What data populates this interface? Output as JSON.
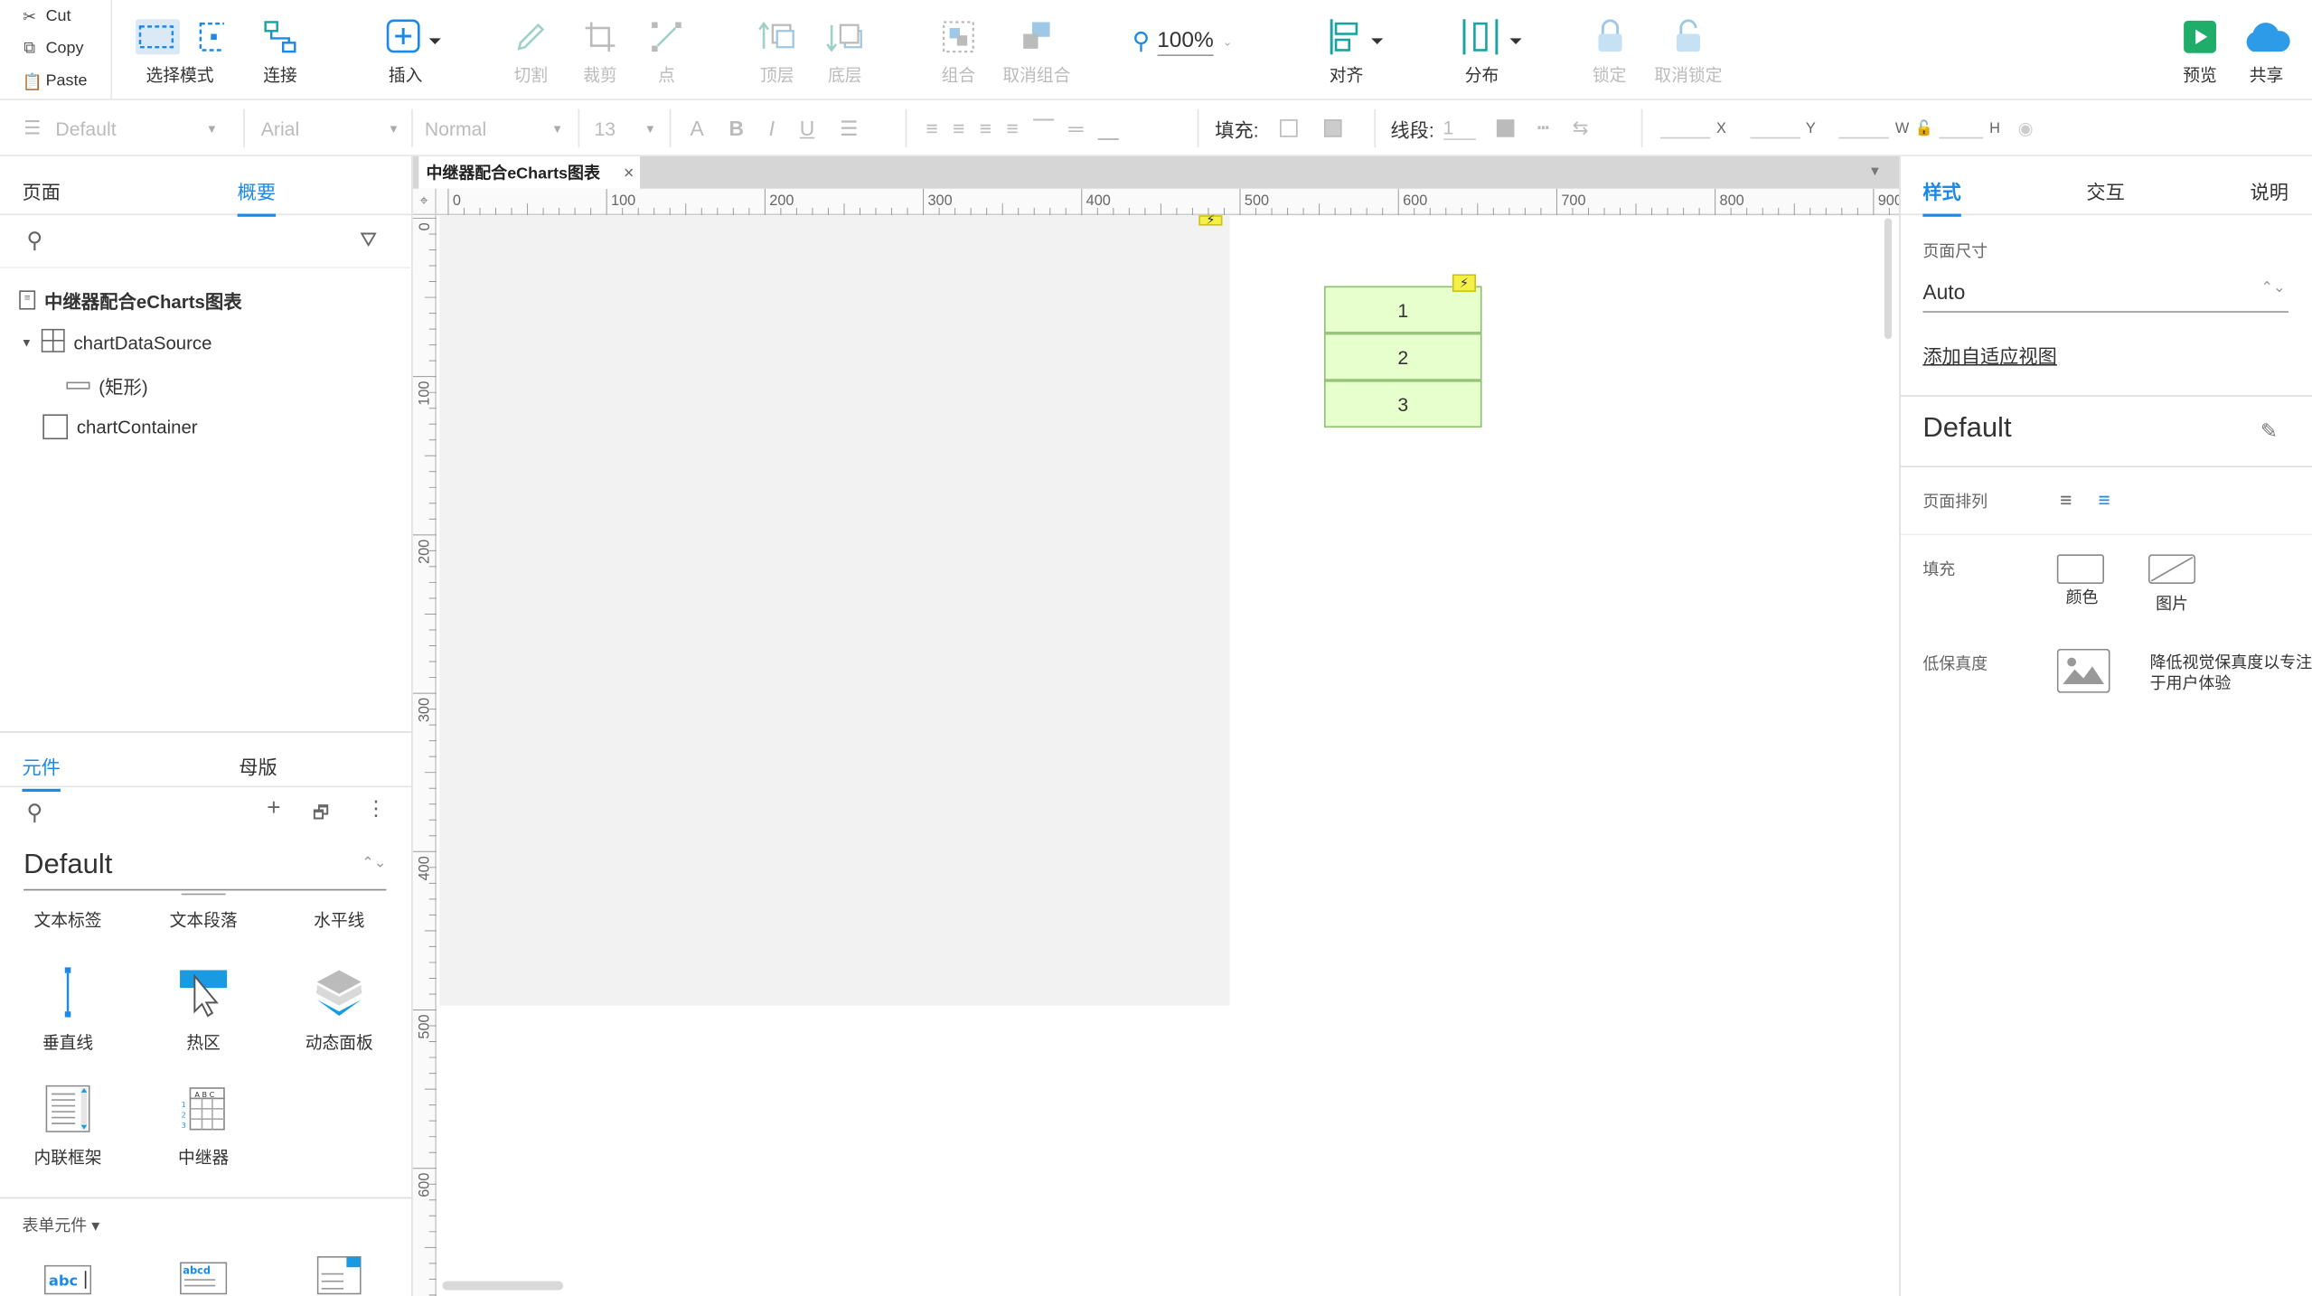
{
  "clipboard": {
    "cut": "Cut",
    "copy": "Copy",
    "paste": "Paste"
  },
  "toolbar": {
    "select_mode": "选择模式",
    "connect": "连接",
    "insert": "插入",
    "cut": "切割",
    "crop": "裁剪",
    "point": "点",
    "top": "顶层",
    "bottom": "底层",
    "group": "组合",
    "ungroup": "取消组合",
    "zoom": "100%",
    "align": "对齐",
    "distribute": "分布",
    "lock": "锁定",
    "unlock": "取消锁定",
    "preview": "预览",
    "share": "共享"
  },
  "format": {
    "style": "Default",
    "font": "Arial",
    "weight": "Normal",
    "size": "13",
    "fill_label": "填充:",
    "stroke_label": "线段:",
    "stroke_value": "1",
    "x": "X",
    "y": "Y",
    "w": "W",
    "h": "H"
  },
  "left": {
    "tab_pages": "页面",
    "tab_outline": "概要",
    "tree": {
      "root": "中继器配合eCharts图表",
      "repeater": "chartDataSource",
      "rect": "(矩形)",
      "container": "chartContainer"
    },
    "lib_tab_widgets": "元件",
    "lib_tab_masters": "母版",
    "library_name": "Default",
    "widgets": [
      "文本标签",
      "文本段落",
      "水平线",
      "垂直线",
      "热区",
      "动态面板",
      "内联框架",
      "中继器"
    ],
    "form_section": "表单元件 ▾"
  },
  "canvas": {
    "doc_tab": "中继器配合eCharts图表",
    "rows": [
      "1",
      "2",
      "3"
    ],
    "h_ticks": [
      "0",
      "100",
      "200",
      "300",
      "400",
      "500",
      "600",
      "700",
      "800",
      "900"
    ],
    "v_ticks": [
      "0",
      "100",
      "200",
      "300",
      "400",
      "500",
      "600"
    ]
  },
  "right": {
    "tab_style": "样式",
    "tab_interact": "交互",
    "tab_notes": "说明",
    "page_size_label": "页面尺寸",
    "page_size_value": "Auto",
    "add_adaptive": "添加自适应视图",
    "style_name": "Default",
    "page_align_label": "页面排列",
    "fill_label": "填充",
    "fill_color": "颜色",
    "fill_image": "图片",
    "low_fidelity_label": "低保真度",
    "low_fidelity_desc": "降低视觉保真度以专注于用户体验"
  },
  "colors": {
    "accent": "#1a8ae6",
    "teal": "#1aa3a3",
    "repeater_fill": "#e6ffcc",
    "repeater_border": "#8fbf73",
    "flash": "#f4f047"
  }
}
